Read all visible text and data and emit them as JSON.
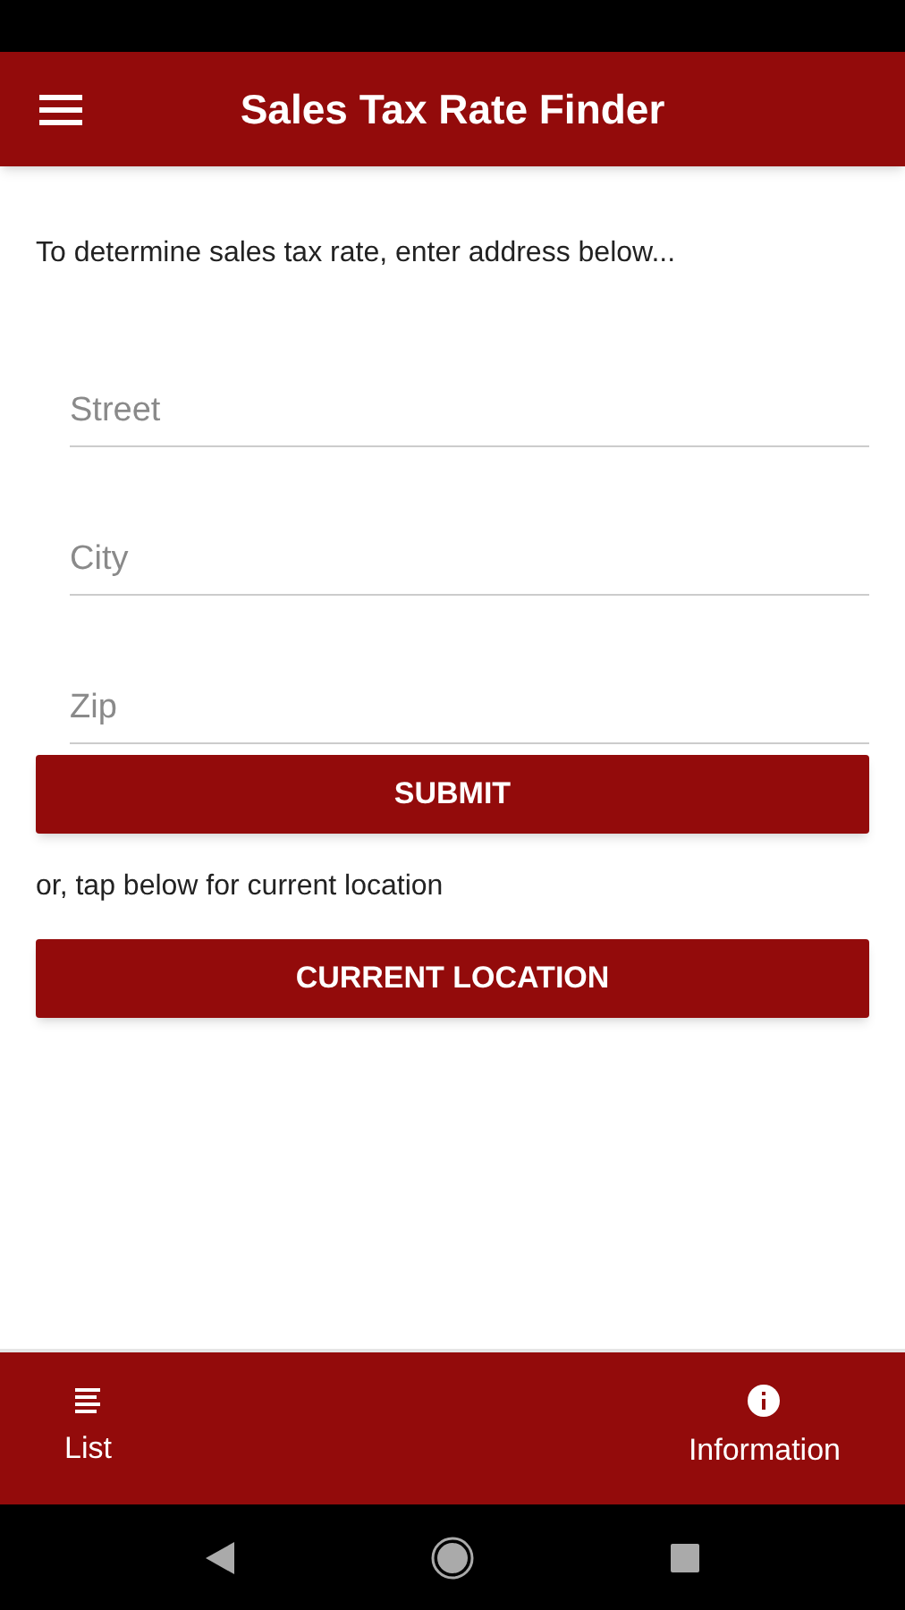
{
  "app_bar": {
    "title": "Sales Tax Rate Finder"
  },
  "intro": "To determine sales tax rate, enter address below...",
  "fields": [
    {
      "placeholder": "Street"
    },
    {
      "placeholder": "City"
    },
    {
      "placeholder": "Zip"
    }
  ],
  "submit_button": "SUBMIT",
  "location_hint": "or, tap below for current location",
  "location_button": "CURRENT LOCATION",
  "bottom_nav": [
    {
      "label": "List",
      "kind": "list"
    },
    {
      "label": "Information",
      "kind": "info"
    }
  ]
}
